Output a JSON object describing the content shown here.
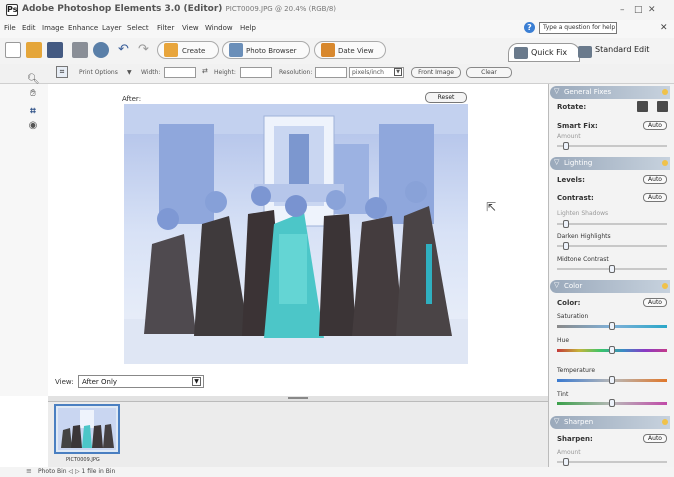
{
  "window": {
    "title": "Adobe Photoshop Elements 3.0 (Editor)",
    "file": "PICT0009.JPG @ 20.4% (RGB/8)",
    "controls": [
      "–",
      "□",
      "✕"
    ]
  },
  "menu": [
    "File",
    "Edit",
    "Image",
    "Enhance",
    "Layer",
    "Select",
    "Filter",
    "View",
    "Window",
    "Help"
  ],
  "help": {
    "placeholder": "Type a question for help",
    "close": "✕"
  },
  "shortcuts": {
    "create": "Create",
    "photo_browser": "Photo Browser",
    "date_view": "Date View",
    "quick_fix": "Quick Fix",
    "standard_edit": "Standard Edit"
  },
  "options": {
    "print_options": "Print Options",
    "width": "Width:",
    "height": "Height:",
    "resolution": "Resolution:",
    "res_units": "pixels/inch",
    "front_image": "Front Image",
    "clear": "Clear"
  },
  "canvas": {
    "after_label": "After",
    "reset": "Reset",
    "view_label": "View:",
    "view_value": "After Only"
  },
  "bin": {
    "thumb_label": "PICT0009.JPG"
  },
  "status": {
    "text": "Photo Bin  ◁  ▷  1 file in Bin"
  },
  "palette": {
    "general": {
      "title": "General Fixes",
      "rotate": "Rotate:",
      "smart_fix": "Smart Fix:",
      "auto": "Auto",
      "amount": "Amount"
    },
    "lighting": {
      "title": "Lighting",
      "levels": "Levels:",
      "contrast": "Contrast:",
      "auto": "Auto",
      "lighten_shadows": "Lighten Shadows",
      "darken_highlights": "Darken Highlights",
      "midtone_contrast": "Midtone Contrast"
    },
    "color": {
      "title": "Color",
      "color_label": "Color:",
      "auto": "Auto",
      "saturation": "Saturation",
      "hue": "Hue",
      "temperature": "Temperature",
      "tint": "Tint"
    },
    "sharpen": {
      "title": "Sharpen",
      "sharpen_label": "Sharpen:",
      "auto": "Auto",
      "amount": "Amount"
    }
  },
  "colors": {
    "panel_header": "#9aa9bb",
    "accent_blue": "#3b7fd4",
    "photo_bg": "#dce6f6"
  }
}
